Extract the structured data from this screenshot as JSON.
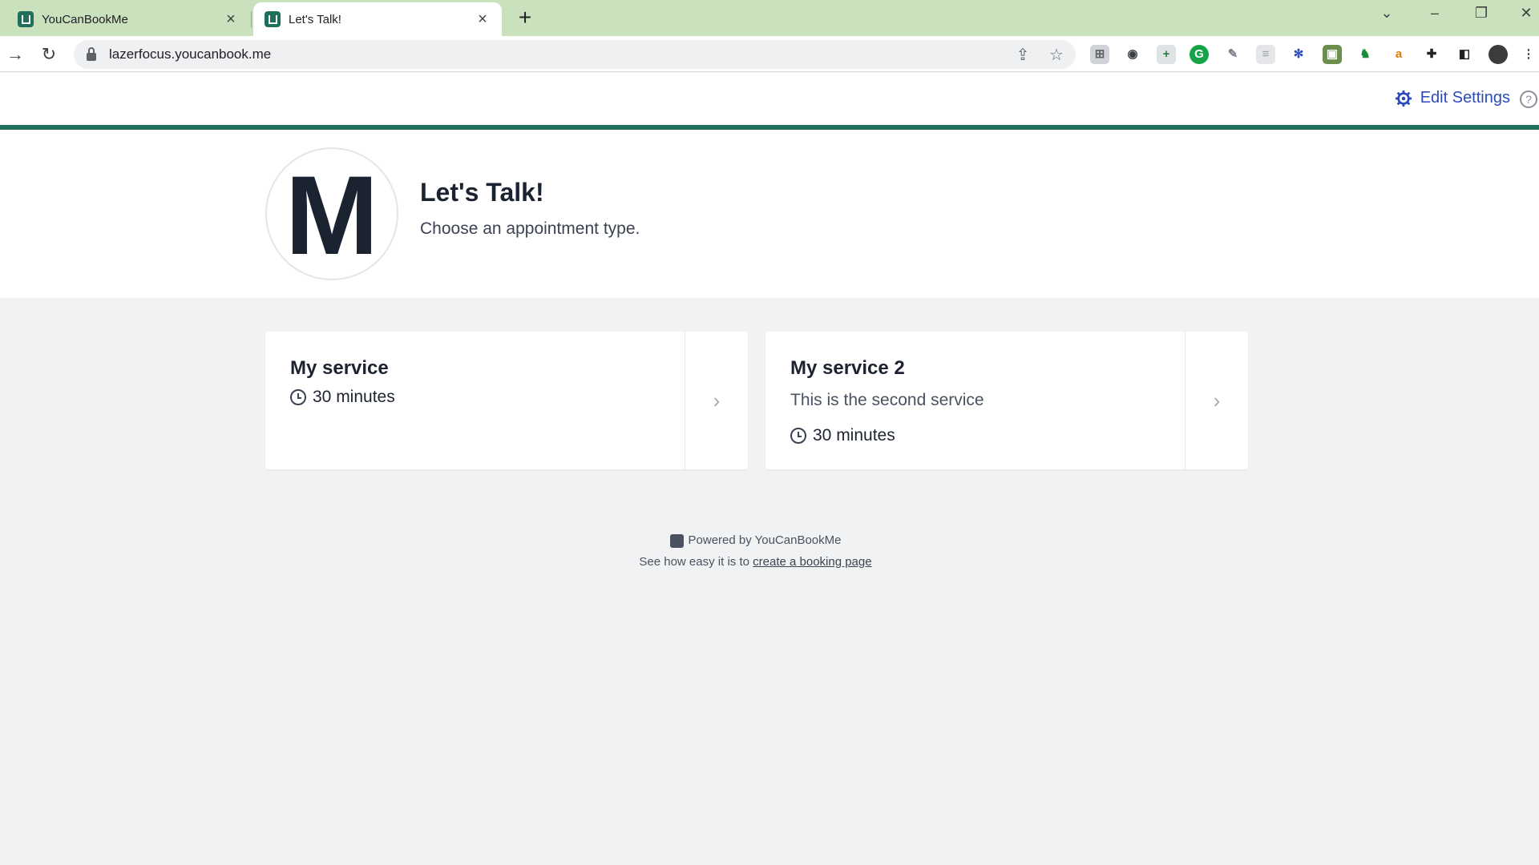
{
  "browser": {
    "tabs": [
      {
        "title": "YouCanBookMe",
        "active": false
      },
      {
        "title": "Let's Talk!",
        "active": true
      }
    ],
    "new_tab_glyph": "+",
    "url": "lazerfocus.youcanbook.me",
    "extension_icons": [
      "share-icon",
      "star-icon",
      "extension-icon",
      "password-icon",
      "extension-icon",
      "grammarly-icon",
      "notes-icon",
      "extension-icon",
      "snowflake-icon",
      "extension-icon",
      "evernote-icon",
      "amazon-icon",
      "puzzle-icon",
      "sidepanel-icon",
      "profile-avatar",
      "menu-icon"
    ]
  },
  "header": {
    "edit_settings": "Edit Settings",
    "help_glyph": "?"
  },
  "hero": {
    "avatar_letter": "M",
    "title": "Let's Talk!",
    "subtitle": "Choose an appointment type."
  },
  "services": [
    {
      "name": "My service",
      "description": "",
      "duration": "30 minutes"
    },
    {
      "name": "My service 2",
      "description": "This is the second service",
      "duration": "30 minutes"
    }
  ],
  "footer": {
    "powered_by": "Powered by YouCanBookMe",
    "see_how": "See how easy it is to",
    "link_text": "create a booking page"
  },
  "colors": {
    "accent": "#2b4bb8",
    "brand_green": "#1f6f5a",
    "tabstrip": "#c9e2bd"
  }
}
